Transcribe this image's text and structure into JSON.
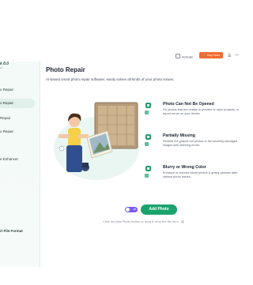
{
  "app": {
    "brand_title": "k 8.0",
    "brand_sub": "Ai"
  },
  "topbar": {
    "activate_label": "Activate",
    "buy_label": "Buy Now",
    "menu_icon": "menu-icon",
    "minimize_icon": "minimize-icon"
  },
  "sidebar": {
    "items": [
      {
        "label": "o Repair",
        "active": false
      },
      {
        "label": "o Repair",
        "active": true
      },
      {
        "label": "Repair",
        "active": false
      },
      {
        "label": "o Repair",
        "active": false
      },
      {
        "label": "e Enhancer",
        "active": false
      }
    ],
    "bottom_label": "rt File Format"
  },
  "main": {
    "title": "Photo Repair",
    "subtitle": "AI-based smart photo repair software, easily solves all kinds of your photo issues.",
    "features": [
      {
        "title": "Photo Can Not Be Opened",
        "desc": "Fix photos that are unable to preview or open properly, or report errors on your device."
      },
      {
        "title": "Partially Missing",
        "desc": "Restore the grayed-out photos or the severely damaged images with stitching errors."
      },
      {
        "title": "Blurry or Wrong Color",
        "desc": "Enhance or colorize blurry photos & grainy pictures after various photo issues."
      }
    ],
    "ai_toggle_label": "AI",
    "add_button_label": "Add Photo",
    "hint": "Click the Add Photo button or drag & drop the file here."
  },
  "colors": {
    "accent": "#1aa46d",
    "buy": "#f06a2c",
    "ai_toggle": "#7a5cf0",
    "sidebar_active": "#dff1ea"
  }
}
